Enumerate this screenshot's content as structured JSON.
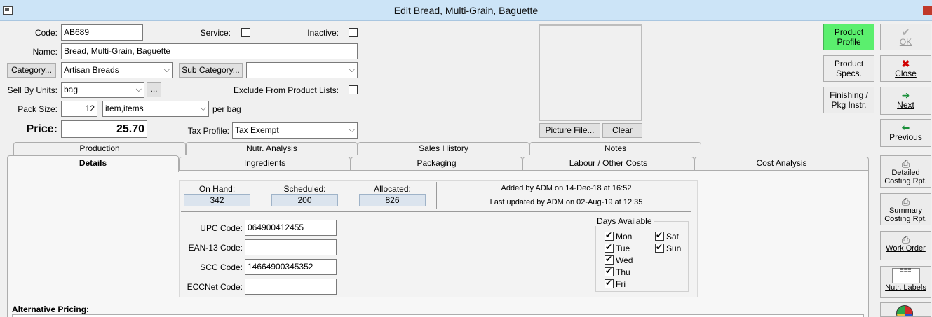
{
  "window": {
    "title": "Edit Bread, Multi-Grain, Baguette"
  },
  "form": {
    "code_label": "Code:",
    "code_value": "AB689",
    "service_label": "Service:",
    "inactive_label": "Inactive:",
    "name_label": "Name:",
    "name_value": "Bread, Multi-Grain, Baguette",
    "category_button": "Category...",
    "category_value": "Artisan Breads",
    "subcategory_button": "Sub Category...",
    "subcategory_value": "",
    "sell_by_label": "Sell By Units:",
    "sell_by_value": "bag",
    "ellipsis_button": "...",
    "exclude_label": "Exclude From Product Lists:",
    "pack_size_label": "Pack Size:",
    "pack_size_value": "12",
    "pack_unit_value": "item,items",
    "per_bag": "per bag",
    "price_label": "Price:",
    "price_value": "25.70",
    "tax_label": "Tax Profile:",
    "tax_value": "Tax Exempt"
  },
  "picture": {
    "file_button": "Picture File...",
    "clear_button": "Clear"
  },
  "side_buttons": {
    "product_profile": "Product Profile",
    "product_specs": "Product Specs.",
    "finishing": "Finishing / Pkg Instr.",
    "ok": "OK",
    "close": "Close",
    "next": "Next",
    "previous": "Previous",
    "detailed_costing": "Detailed Costing Rpt.",
    "summary_costing": "Summary Costing Rpt.",
    "work_order": "Work Order",
    "nutr_labels": "Nutr. Labels"
  },
  "tabs_back": [
    "Production",
    "Nutr. Analysis",
    "Sales History",
    "Notes"
  ],
  "tabs_front": [
    "Details",
    "Ingredients",
    "Packaging",
    "Labour / Other Costs",
    "Cost Analysis"
  ],
  "details": {
    "on_hand_label": "On Hand:",
    "on_hand": "342",
    "scheduled_label": "Scheduled:",
    "scheduled": "200",
    "allocated_label": "Allocated:",
    "allocated": "826",
    "added_by": "Added by ADM on 14-Dec-18 at 16:52",
    "updated_by": "Last updated by ADM on 02-Aug-19 at 12:35",
    "upc_label": "UPC Code:",
    "upc_value": "064900412455",
    "ean_label": "EAN-13 Code:",
    "ean_value": "",
    "scc_label": "SCC Code:",
    "scc_value": "14664900345352",
    "eccnet_label": "ECCNet Code:",
    "eccnet_value": "",
    "days_title": "Days Available",
    "days": [
      "Mon",
      "Tue",
      "Wed",
      "Thu",
      "Fri",
      "Sat",
      "Sun"
    ],
    "alt_pricing_label": "Alternative Pricing:"
  }
}
